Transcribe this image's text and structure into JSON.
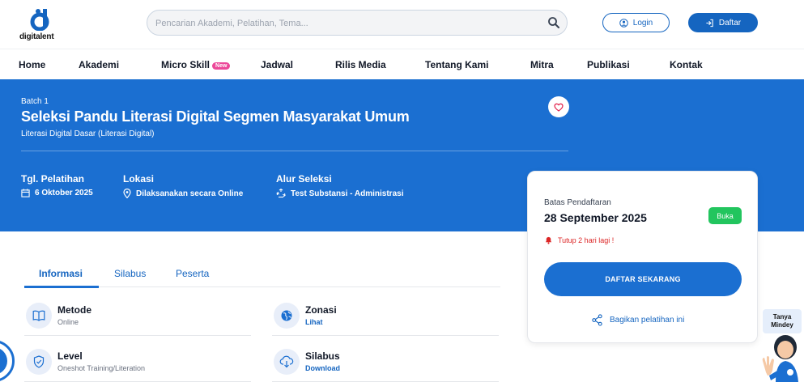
{
  "header": {
    "logo_text": "digitalent",
    "search_placeholder": "Pencarian Akademi, Pelatihan, Tema...",
    "login_label": "Login",
    "register_label": "Daftar"
  },
  "nav": {
    "items": [
      {
        "label": "Home"
      },
      {
        "label": "Akademi"
      },
      {
        "label": "Micro Skill",
        "badge": "New"
      },
      {
        "label": "Jadwal"
      },
      {
        "label": "Rilis Media"
      },
      {
        "label": "Tentang Kami"
      },
      {
        "label": "Mitra"
      },
      {
        "label": "Publikasi"
      },
      {
        "label": "Kontak"
      }
    ]
  },
  "hero": {
    "batch": "Batch 1",
    "title": "Seleksi Pandu Literasi Digital Segmen Masyarakat Umum",
    "subtitle": "Literasi Digital Dasar (Literasi Digital)",
    "training_date_label": "Tgl. Pelatihan",
    "training_date": "6 Oktober 2025",
    "location_label": "Lokasi",
    "location": "Dilaksanakan secara Online",
    "selection_label": "Alur Seleksi",
    "selection": "Test Substansi - Administrasi"
  },
  "registration": {
    "deadline_label": "Batas Pendaftaran",
    "deadline": "28 September 2025",
    "status": "Buka",
    "warning": "Tutup 2 hari lagi !",
    "cta": "DAFTAR SEKARANG",
    "share": "Bagikan pelatihan ini"
  },
  "tabs": [
    {
      "label": "Informasi"
    },
    {
      "label": "Silabus"
    },
    {
      "label": "Peserta"
    }
  ],
  "details": {
    "metode": {
      "title": "Metode",
      "value": "Online"
    },
    "zonasi": {
      "title": "Zonasi",
      "value": "Lihat"
    },
    "level": {
      "title": "Level",
      "value": "Oneshot Training/Literation"
    },
    "silabus": {
      "title": "Silabus",
      "value": "Download"
    }
  },
  "assistant": {
    "label": "Tanya Mindey"
  },
  "colors": {
    "primary": "#1b6fd1",
    "accent_pink": "#ec4899",
    "status_green": "#22c55e",
    "warning_red": "#dc2626"
  }
}
